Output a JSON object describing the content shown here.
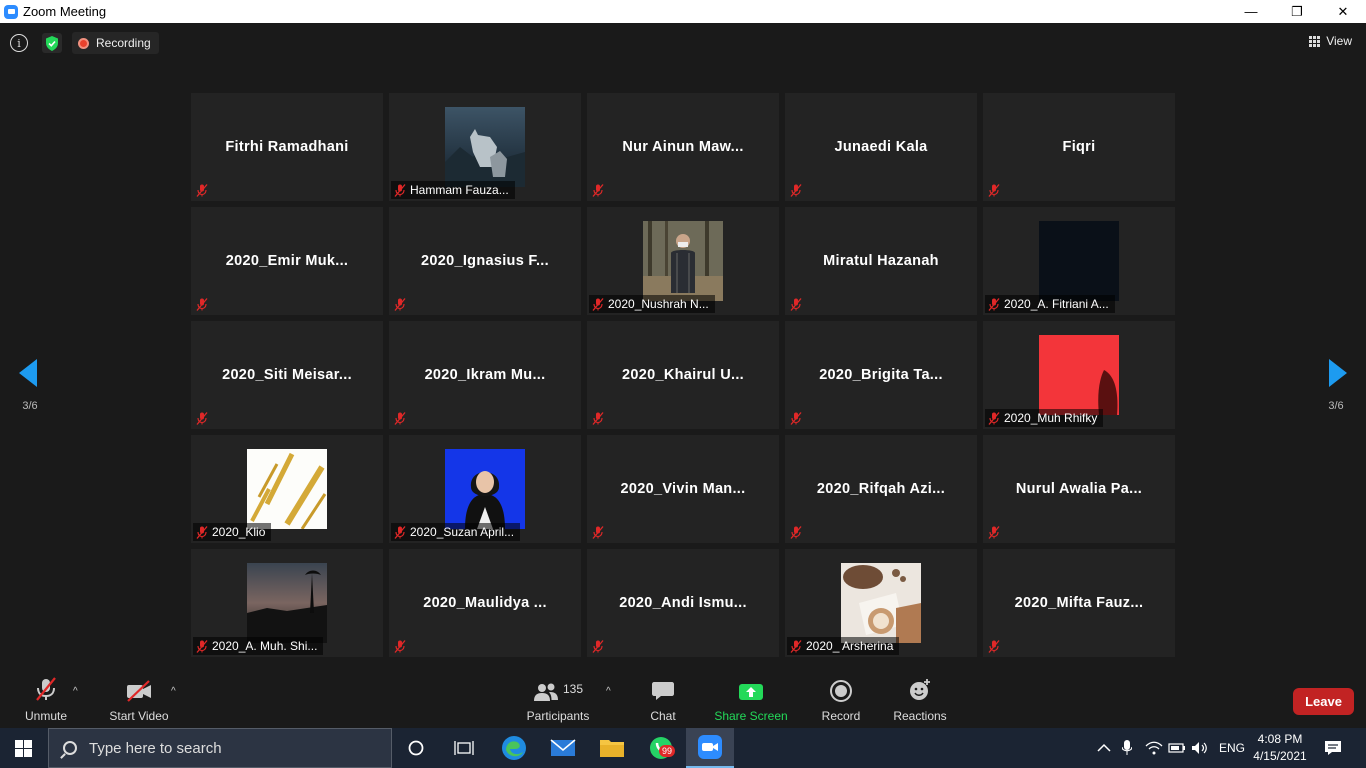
{
  "window": {
    "title": "Zoom Meeting",
    "controls": [
      "—",
      "❐",
      "✕"
    ]
  },
  "topbar": {
    "recording_label": "Recording",
    "view_label": "View"
  },
  "pagination": {
    "left_page": "3/6",
    "right_page": "3/6"
  },
  "participants": [
    {
      "name": "Fitrhi Ramadhani",
      "has_video": false
    },
    {
      "name": "Hammam Fauza...",
      "has_video": true,
      "image": "wolves"
    },
    {
      "name": "Nur  Ainun  Maw...",
      "has_video": false
    },
    {
      "name": "Junaedi Kala",
      "has_video": false
    },
    {
      "name": "Fiqri",
      "has_video": false
    },
    {
      "name": "2020_Emir  Muk...",
      "has_video": false
    },
    {
      "name": "2020_Ignasius  F...",
      "has_video": false
    },
    {
      "name": "2020_Nushrah N...",
      "has_video": true,
      "image": "forest-person"
    },
    {
      "name": "Miratul Hazanah",
      "has_video": false
    },
    {
      "name": "2020_A. Fitriani A...",
      "has_video": true,
      "image": "dark"
    },
    {
      "name": "2020_Siti  Meisar...",
      "has_video": false
    },
    {
      "name": "2020_Ikram  Mu...",
      "has_video": false
    },
    {
      "name": "2020_Khairul  U...",
      "has_video": false
    },
    {
      "name": "2020_Brigita  Ta...",
      "has_video": false
    },
    {
      "name": "2020_Muh Rhifky",
      "has_video": true,
      "image": "red"
    },
    {
      "name": "2020_Klio",
      "has_video": true,
      "image": "gold-stripes"
    },
    {
      "name": "2020_Suzan April...",
      "has_video": true,
      "image": "portrait-blue"
    },
    {
      "name": "2020_Vivin  Man...",
      "has_video": false
    },
    {
      "name": "2020_Rifqah  Azi...",
      "has_video": false
    },
    {
      "name": "Nurul Awalia Pa...",
      "has_video": false
    },
    {
      "name": "2020_A. Muh. Shi...",
      "has_video": true,
      "image": "sunset"
    },
    {
      "name": "2020_Maulidya ...",
      "has_video": false
    },
    {
      "name": "2020_Andi  Ismu...",
      "has_video": false
    },
    {
      "name": "2020_ Arsherina",
      "has_video": true,
      "image": "coffee"
    },
    {
      "name": "2020_Mifta  Fauz...",
      "has_video": false
    }
  ],
  "toolbar": {
    "unmute": "Unmute",
    "start_video": "Start Video",
    "participants": "Participants",
    "participants_count": "135",
    "chat": "Chat",
    "share_screen": "Share Screen",
    "record": "Record",
    "reactions": "Reactions",
    "leave": "Leave"
  },
  "taskbar": {
    "search_placeholder": "Type here to search",
    "whatsapp_badge": "99",
    "language": "ENG",
    "time": "4:08 PM",
    "date": "4/15/2021"
  },
  "colors": {
    "zoom_blue": "#2D8CFF",
    "share_green": "#23D959",
    "leave_red": "#C22323",
    "recording_red": "#E8412C",
    "muted_red": "#E02828"
  }
}
